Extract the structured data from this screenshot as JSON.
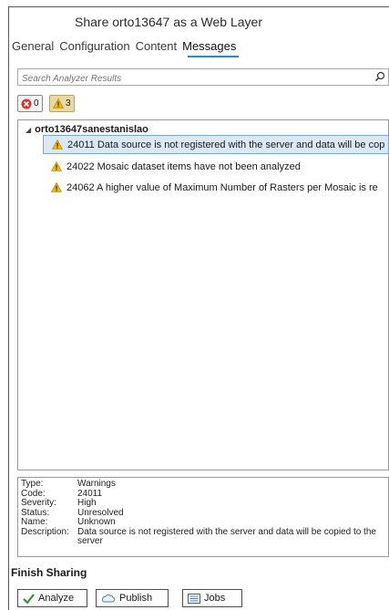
{
  "header": {
    "title": "Share orto13647 as a Web Layer"
  },
  "tabs": [
    {
      "label": "General"
    },
    {
      "label": "Configuration"
    },
    {
      "label": "Content"
    },
    {
      "label": "Messages"
    }
  ],
  "search": {
    "placeholder": "Search Analyzer Results"
  },
  "filters": {
    "errors_count": "0",
    "warnings_count": "3"
  },
  "results": {
    "root_label": "orto13647sanestanislao",
    "items": [
      {
        "text": "24011 Data source is not registered with the server and data will be cop",
        "icon": "warning-icon"
      },
      {
        "text": "24022 Mosaic dataset items have not been analyzed",
        "icon": "warning-icon"
      },
      {
        "text": "24062 A higher value of Maximum Number of Rasters per Mosaic is re",
        "icon": "warning-icon"
      }
    ]
  },
  "details": {
    "type_label": "Type:",
    "type_value": "Warnings",
    "code_label": "Code:",
    "code_value": "24011",
    "severity_label": "Severity:",
    "severity_value": "High",
    "status_label": "Status:",
    "status_value": "Unresolved",
    "name_label": "Name:",
    "name_value": "Unknown",
    "description_label": "Description:",
    "description_value": "Data source is not registered with the server and data will be copied to the server"
  },
  "footer": {
    "section_title": "Finish Sharing",
    "analyze_label": "Analyze",
    "publish_label": "Publish",
    "jobs_label": "Jobs"
  },
  "colors": {
    "accent": "#2f86d2",
    "error": "#d9342b",
    "warning": "#f2b705",
    "selection": "#dbe9f7"
  }
}
